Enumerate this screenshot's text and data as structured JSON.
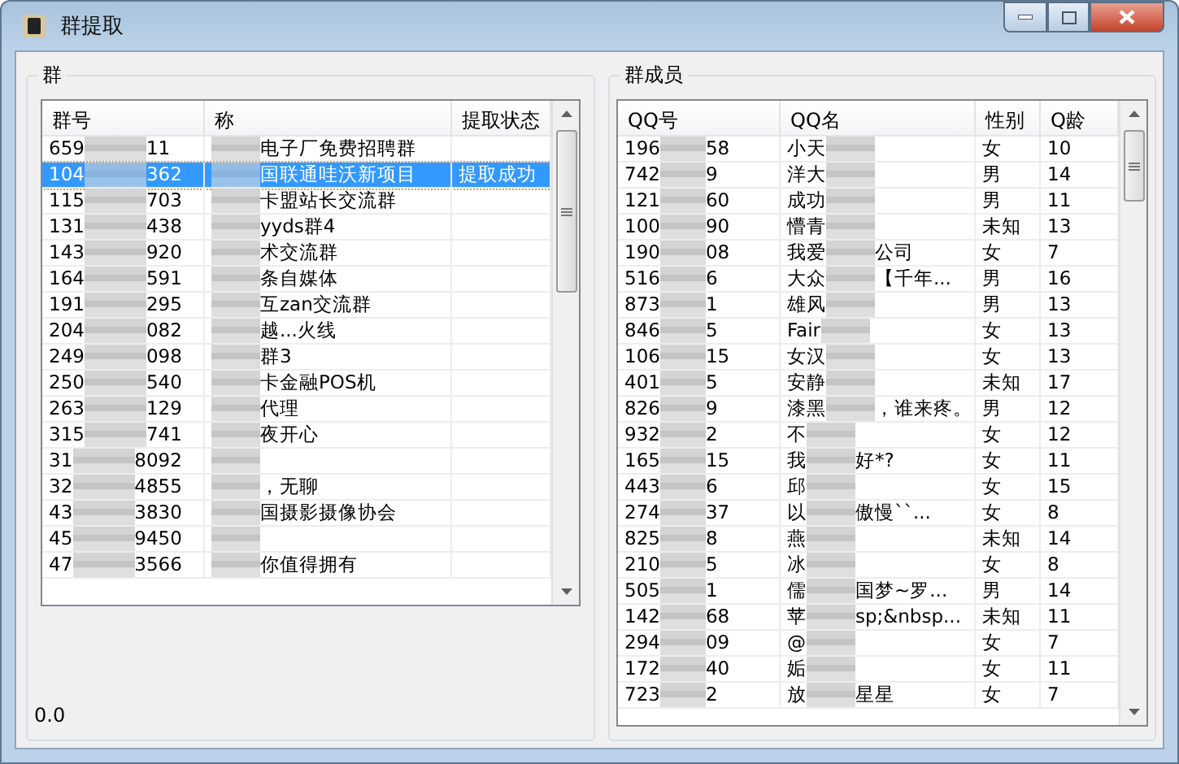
{
  "window": {
    "title": "群提取"
  },
  "groups_panel": {
    "title": "群",
    "columns": [
      "群号",
      "称",
      "提取状态"
    ],
    "rows": [
      {
        "number_head": "659",
        "number_tail": "11",
        "name": "电子厂免费招聘群",
        "status": "",
        "selected": false
      },
      {
        "number_head": "104",
        "number_tail": "362",
        "name": "国联通哇沃新项目",
        "status": "提取成功",
        "selected": true
      },
      {
        "number_head": "115",
        "number_tail": "703",
        "name": "卡盟站长交流群",
        "status": "",
        "selected": false
      },
      {
        "number_head": "131",
        "number_tail": "438",
        "name": "yyds群4",
        "status": "",
        "selected": false
      },
      {
        "number_head": "143",
        "number_tail": "920",
        "name": "术交流群",
        "status": "",
        "selected": false
      },
      {
        "number_head": "164",
        "number_tail": "591",
        "name": "条自媒体",
        "status": "",
        "selected": false
      },
      {
        "number_head": "191",
        "number_tail": "295",
        "name": "互zan交流群",
        "status": "",
        "selected": false
      },
      {
        "number_head": "204",
        "number_tail": "082",
        "name": "越...火线",
        "status": "",
        "selected": false
      },
      {
        "number_head": "249",
        "number_tail": "098",
        "name": "群3",
        "status": "",
        "selected": false
      },
      {
        "number_head": "250",
        "number_tail": "540",
        "name": "卡金融POS机",
        "status": "",
        "selected": false
      },
      {
        "number_head": "263",
        "number_tail": "129",
        "name": "代理",
        "status": "",
        "selected": false
      },
      {
        "number_head": "315",
        "number_tail": "741",
        "name": "夜开心",
        "status": "",
        "selected": false
      },
      {
        "number_head": "31",
        "number_tail": "8092",
        "name": "",
        "status": "",
        "selected": false
      },
      {
        "number_head": "32",
        "number_tail": "4855",
        "name": "，无聊",
        "status": "",
        "selected": false
      },
      {
        "number_head": "43",
        "number_tail": "3830",
        "name": "国摄影摄像协会",
        "status": "",
        "selected": false
      },
      {
        "number_head": "45",
        "number_tail": "9450",
        "name": "",
        "status": "",
        "selected": false
      },
      {
        "number_head": "47",
        "number_tail": "3566",
        "name": "你值得拥有",
        "status": "",
        "selected": false
      }
    ],
    "progress_text": "0.0"
  },
  "members_panel": {
    "title": "群成员",
    "columns": [
      "QQ号",
      "QQ名",
      "性别",
      "Q龄"
    ],
    "rows": [
      {
        "qq_head": "196",
        "qq_tail": "58",
        "name_head": "小天",
        "name_tail": "",
        "gender": "女",
        "age": "10"
      },
      {
        "qq_head": "742",
        "qq_tail": "9",
        "name_head": "洋大",
        "name_tail": "",
        "gender": "男",
        "age": "14"
      },
      {
        "qq_head": "121",
        "qq_tail": "60",
        "name_head": "成功",
        "name_tail": "",
        "gender": "男",
        "age": "11"
      },
      {
        "qq_head": "100",
        "qq_tail": "90",
        "name_head": "懵青",
        "name_tail": "",
        "gender": "未知",
        "age": "13"
      },
      {
        "qq_head": "190",
        "qq_tail": "08",
        "name_head": "我爱",
        "name_tail": "公司",
        "gender": "女",
        "age": "7"
      },
      {
        "qq_head": "516",
        "qq_tail": "6",
        "name_head": "大众",
        "name_tail": "【千年...",
        "gender": "男",
        "age": "16"
      },
      {
        "qq_head": "873",
        "qq_tail": "1",
        "name_head": "雄风",
        "name_tail": "",
        "gender": "男",
        "age": "13"
      },
      {
        "qq_head": "846",
        "qq_tail": "5",
        "name_head": "Fair",
        "name_tail": "",
        "gender": "女",
        "age": "13"
      },
      {
        "qq_head": "106",
        "qq_tail": "15",
        "name_head": "女汉",
        "name_tail": "",
        "gender": "女",
        "age": "13"
      },
      {
        "qq_head": "401",
        "qq_tail": "5",
        "name_head": "安静",
        "name_tail": "",
        "gender": "未知",
        "age": "17"
      },
      {
        "qq_head": "826",
        "qq_tail": "9",
        "name_head": "漆黑",
        "name_tail": "，谁来疼。",
        "gender": "男",
        "age": "12"
      },
      {
        "qq_head": "932",
        "qq_tail": "2",
        "name_head": "不",
        "name_tail": "",
        "gender": "女",
        "age": "12"
      },
      {
        "qq_head": "165",
        "qq_tail": "15",
        "name_head": "我",
        "name_tail": "好*?",
        "gender": "女",
        "age": "11"
      },
      {
        "qq_head": "443",
        "qq_tail": "6",
        "name_head": "邱",
        "name_tail": "",
        "gender": "女",
        "age": "15"
      },
      {
        "qq_head": "274",
        "qq_tail": "37",
        "name_head": "以",
        "name_tail": "傲慢``...",
        "gender": "女",
        "age": "8"
      },
      {
        "qq_head": "825",
        "qq_tail": "8",
        "name_head": "燕",
        "name_tail": "",
        "gender": "未知",
        "age": "14"
      },
      {
        "qq_head": "210",
        "qq_tail": "5",
        "name_head": "冰",
        "name_tail": "",
        "gender": "女",
        "age": "8"
      },
      {
        "qq_head": "505",
        "qq_tail": "1",
        "name_head": "儒",
        "name_tail": "国梦~罗...",
        "gender": "男",
        "age": "14"
      },
      {
        "qq_head": "142",
        "qq_tail": "68",
        "name_head": "苹",
        "name_tail": "sp;&nbsp...",
        "gender": "未知",
        "age": "11"
      },
      {
        "qq_head": "294",
        "qq_tail": "09",
        "name_head": "@",
        "name_tail": "",
        "gender": "女",
        "age": "7"
      },
      {
        "qq_head": "172",
        "qq_tail": "40",
        "name_head": "姤",
        "name_tail": "",
        "gender": "女",
        "age": "11"
      },
      {
        "qq_head": "723",
        "qq_tail": "2",
        "name_head": "放",
        "name_tail": "星星",
        "gender": "女",
        "age": "7"
      }
    ]
  }
}
